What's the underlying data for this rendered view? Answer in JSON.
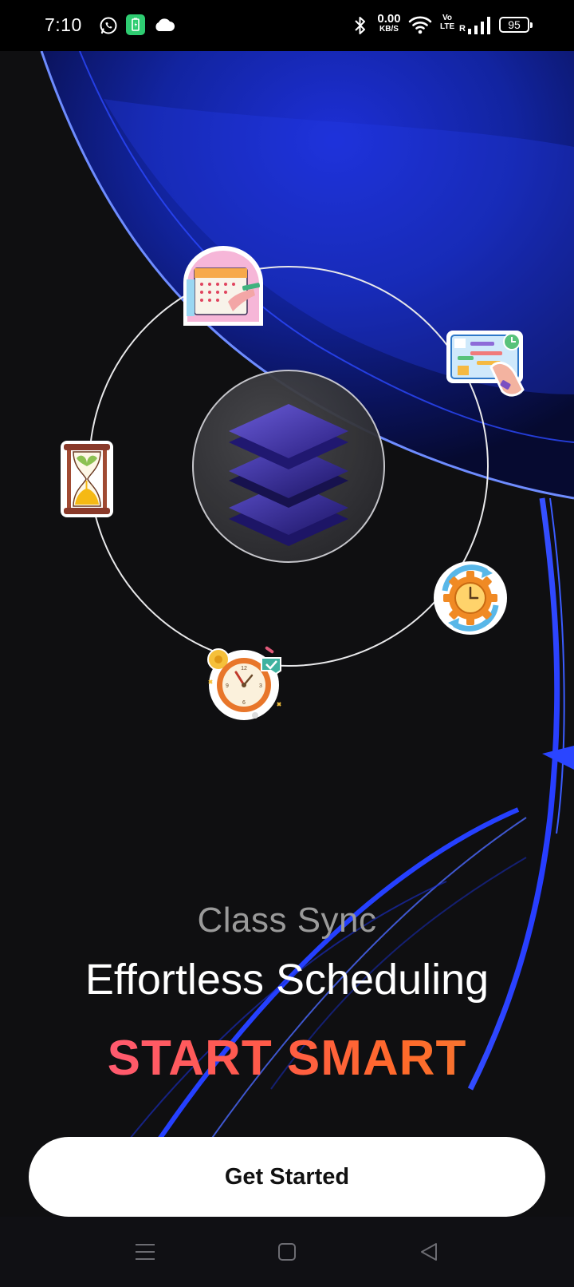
{
  "status_bar": {
    "time": "7:10",
    "net_speed_value": "0.00",
    "net_speed_unit": "KB/S",
    "volte_label": "Vo\nLTE",
    "roaming": "R",
    "battery": "95",
    "left_icons": [
      "whatsapp-icon",
      "battery-saver-icon",
      "cloud-icon"
    ],
    "right_icons": [
      "bluetooth-icon",
      "wifi-icon",
      "signal-icon"
    ]
  },
  "hero": {
    "center_icon": "layers-icon",
    "stickers": [
      "calendar-sticker",
      "task-board-sticker",
      "hourglass-sticker",
      "clock-gear-sticker",
      "alarm-clock-sticker"
    ]
  },
  "content": {
    "app_name": "Class Sync",
    "tagline": "Effortless Scheduling",
    "cta_text": "START SMART",
    "button_label": "Get Started"
  },
  "nav_bar": {
    "buttons": [
      "menu-icon",
      "home-icon",
      "back-icon"
    ]
  },
  "colors": {
    "background": "#0f0f11",
    "accent_blue": "#1a3cff",
    "gradient_start": "#ff5a8a",
    "gradient_end": "#e8823a",
    "button_bg": "#ffffff"
  }
}
